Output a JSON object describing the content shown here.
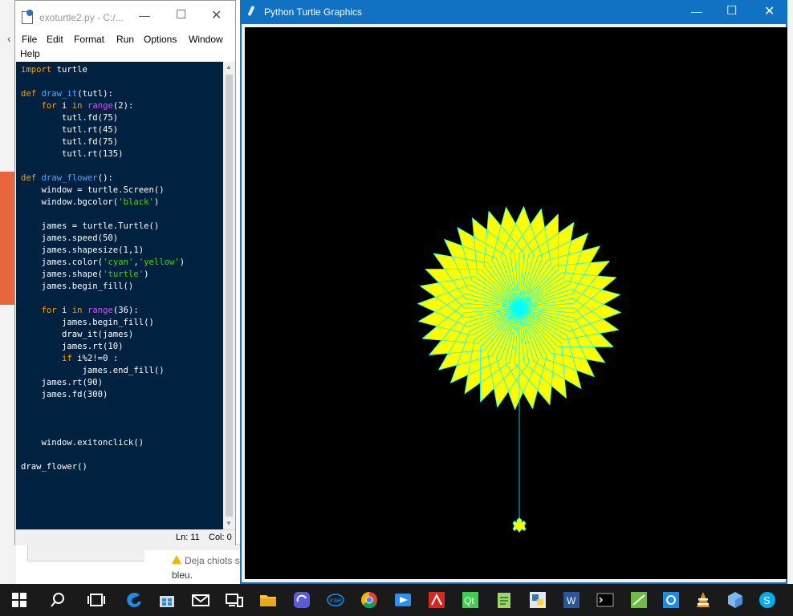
{
  "idle": {
    "title": "exoturtle2.py - C:/...",
    "menus": [
      "File",
      "Edit",
      "Format",
      "Run",
      "Options",
      "Window",
      "Help"
    ],
    "code_lines": [
      "import turtle",
      "",
      "def draw_it(tutl):",
      "    for i in range(2):",
      "        tutl.fd(75)",
      "        tutl.rt(45)",
      "        tutl.fd(75)",
      "        tutl.rt(135)",
      "",
      "def draw_flower():",
      "    window = turtle.Screen()",
      "    window.bgcolor('black')",
      "",
      "    james = turtle.Turtle()",
      "    james.speed(50)",
      "    james.shapesize(1,1)",
      "    james.color('cyan','yellow')",
      "    james.shape('turtle')",
      "    james.begin_fill()",
      "",
      "    for i in range(36):",
      "        james.begin_fill()",
      "        draw_it(james)",
      "        james.rt(10)",
      "        if i%2!=0 :",
      "            james.end_fill()",
      "    james.rt(90)",
      "    james.fd(300)",
      "",
      "",
      "",
      "    window.exitonclick()",
      "",
      "draw_flower()"
    ],
    "status_line": "Ln: 11",
    "status_col": "Col: 0"
  },
  "turtle_window": {
    "title": "Python Turtle Graphics",
    "background": "#000000",
    "fill_color": "#ffff00",
    "pen_color": "#00ffff"
  },
  "background": {
    "notify_line1": "Deja chiots s",
    "notify_line2": "bleu."
  },
  "taskbar": {
    "icons": [
      "windows-start-icon",
      "search-icon",
      "task-view-icon",
      "edge-icon",
      "store-icon",
      "mail-icon",
      "devices-icon",
      "file-explorer-icon",
      "app-blue-icon",
      "intel-icon",
      "chrome-icon",
      "app-arrow-icon",
      "acrobat-icon",
      "qt-icon",
      "notepad-icon",
      "python-idle-icon",
      "word-icon",
      "terminal-icon",
      "app-green-icon",
      "app-camera-icon",
      "vlc-icon",
      "app-cube-icon",
      "skype-icon"
    ]
  }
}
